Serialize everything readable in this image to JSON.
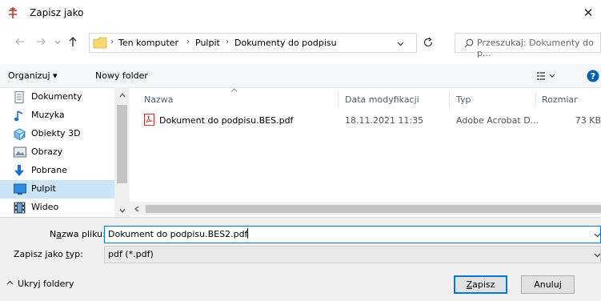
{
  "window": {
    "title": "Zapisz jako",
    "close_glyph": "✕"
  },
  "address": {
    "path": [
      "Ten komputer",
      "Pulpit",
      "Dokumenty do podpisu"
    ],
    "search_placeholder": "Przeszukaj: Dokumenty do p..."
  },
  "toolbar": {
    "organize_label": "Organizuj ▾",
    "new_folder_label": "Nowy folder"
  },
  "sidebar": {
    "items": [
      {
        "label": "Dokumenty",
        "icon": "documents-icon"
      },
      {
        "label": "Muzyka",
        "icon": "music-icon"
      },
      {
        "label": "Obiekty 3D",
        "icon": "objects-3d-icon"
      },
      {
        "label": "Obrazy",
        "icon": "pictures-icon"
      },
      {
        "label": "Pobrane",
        "icon": "downloads-icon"
      },
      {
        "label": "Pulpit",
        "icon": "desktop-icon",
        "selected": true
      },
      {
        "label": "Wideo",
        "icon": "video-icon"
      }
    ]
  },
  "filelist": {
    "columns": [
      "Nazwa",
      "Data modyfikacji",
      "Typ",
      "Rozmiar"
    ],
    "rows": [
      {
        "name": "Dokument do podpisu.BES.pdf",
        "modified": "18.11.2021 11:35",
        "type": "Adobe Acrobat D...",
        "size": "73 KB"
      }
    ]
  },
  "form": {
    "filename_label_prefix": "N",
    "filename_label_ul": "a",
    "filename_label_rest": "zwa pliku:",
    "filename_value": "Dokument do podpisu.BES2.pdf",
    "filetype_label_pre": "Zapisz jako ",
    "filetype_label_ul": "t",
    "filetype_label_rest": "yp:",
    "filetype_value": "pdf (*.pdf)"
  },
  "footer": {
    "hide_folders_label": "Ukryj foldery",
    "save_ul": "Z",
    "save_rest": "apisz",
    "cancel_label": "Anuluj"
  },
  "colors": {
    "accent": "#0078d7",
    "selection": "#cce4f7",
    "pdf_red": "#d93025"
  }
}
